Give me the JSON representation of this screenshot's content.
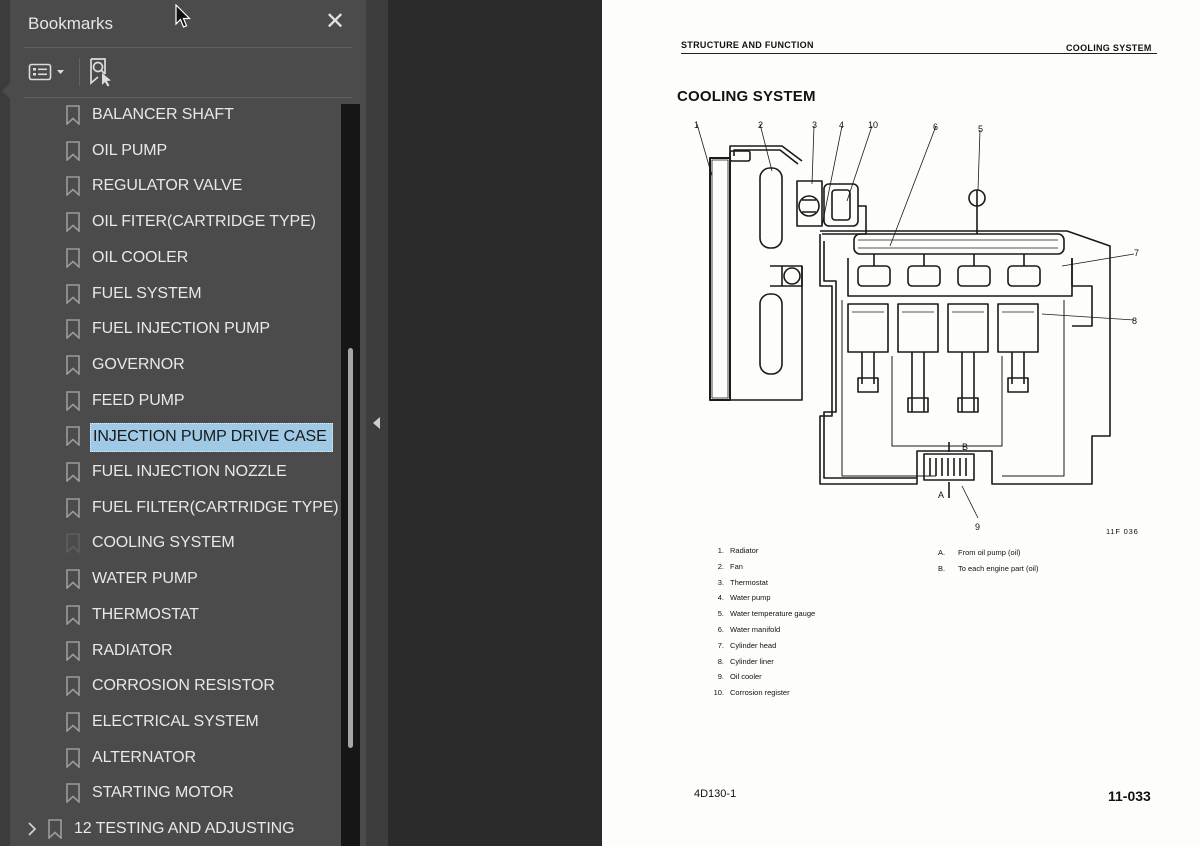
{
  "panel": {
    "title": "Bookmarks",
    "close_label": "✕",
    "items": [
      {
        "label": "BALANCER SHAFT",
        "selected": false
      },
      {
        "label": "OIL PUMP",
        "selected": false
      },
      {
        "label": "REGULATOR VALVE",
        "selected": false
      },
      {
        "label": "OIL FITER(CARTRIDGE TYPE)",
        "selected": false
      },
      {
        "label": "OIL COOLER",
        "selected": false
      },
      {
        "label": "FUEL SYSTEM",
        "selected": false
      },
      {
        "label": "FUEL INJECTION PUMP",
        "selected": false
      },
      {
        "label": "GOVERNOR",
        "selected": false
      },
      {
        "label": "FEED PUMP",
        "selected": false
      },
      {
        "label": "INJECTION PUMP DRIVE CASE",
        "selected": true
      },
      {
        "label": "FUEL INJECTION NOZZLE",
        "selected": false
      },
      {
        "label": "FUEL FILTER(CARTRIDGE TYPE)",
        "selected": false
      },
      {
        "label": "COOLING SYSTEM",
        "selected": false
      },
      {
        "label": "WATER PUMP",
        "selected": false
      },
      {
        "label": "THERMOSTAT",
        "selected": false
      },
      {
        "label": "RADIATOR",
        "selected": false
      },
      {
        "label": "CORROSION RESISTOR",
        "selected": false
      },
      {
        "label": "ELECTRICAL SYSTEM",
        "selected": false
      },
      {
        "label": "ALTERNATOR",
        "selected": false
      },
      {
        "label": "STARTING MOTOR",
        "selected": false
      }
    ],
    "parent_item": {
      "label": "12 TESTING AND ADJUSTING",
      "icon": "chevron-right-icon"
    }
  },
  "page": {
    "header_left": "STRUCTURE AND FUNCTION",
    "header_right": "COOLING SYSTEM",
    "title": "COOLING SYSTEM",
    "figure_code": "11F 036",
    "callouts": {
      "n1": "1",
      "n2": "2",
      "n3": "3",
      "n4": "4",
      "n10": "10",
      "n6": "6",
      "n5": "5",
      "n7": "7",
      "n8": "8",
      "n9": "9",
      "A": "A",
      "B": "B"
    },
    "parts": [
      {
        "num": "1.",
        "name": "Radiator"
      },
      {
        "num": "2.",
        "name": "Fan"
      },
      {
        "num": "3.",
        "name": "Thermostat"
      },
      {
        "num": "4.",
        "name": "Water pump"
      },
      {
        "num": "5.",
        "name": "Water temperature gauge"
      },
      {
        "num": "6.",
        "name": "Water manifold"
      },
      {
        "num": "7.",
        "name": "Cylinder head"
      },
      {
        "num": "8.",
        "name": "Cylinder liner"
      },
      {
        "num": "9.",
        "name": "Oil cooler"
      },
      {
        "num": "10.",
        "name": "Corrosion register"
      }
    ],
    "legend": [
      {
        "key": "A.",
        "text": "From oil pump (oil)"
      },
      {
        "key": "B.",
        "text": "To each engine part (oil)"
      }
    ],
    "model": "4D130-1",
    "page_number": "11-033"
  },
  "colors": {
    "panel_bg": "#4b4b4b",
    "selection": "#9fc9e4",
    "canvas_bg": "#2b2b2b",
    "page_bg": "#fdfdfb"
  }
}
